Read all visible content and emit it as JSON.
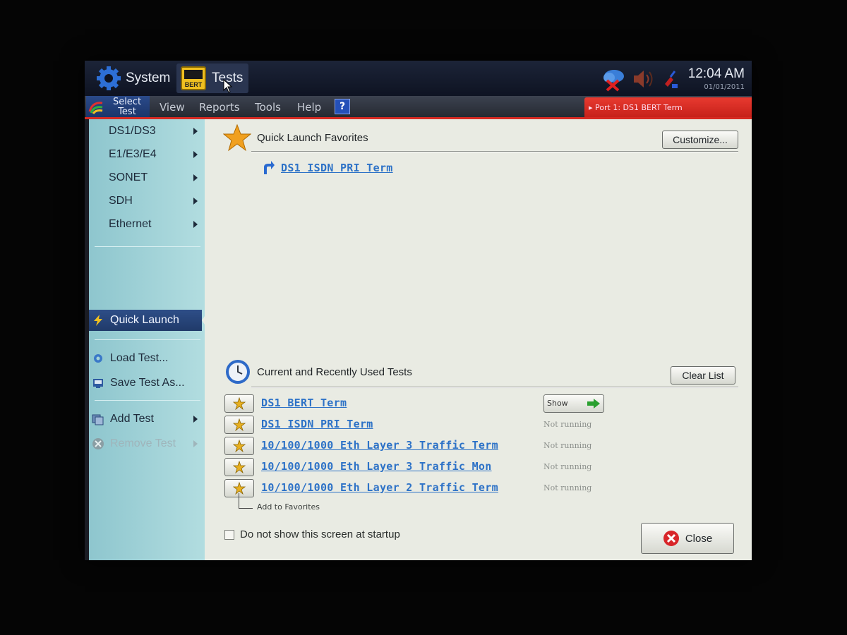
{
  "topbar": {
    "system_label": "System",
    "tests_label": "Tests",
    "bert_icon_text": "BERT",
    "clock_time": "12:04 AM",
    "clock_date": "01/01/2011"
  },
  "menubar": {
    "select_test_line1": "Select",
    "select_test_line2": "Test",
    "items": [
      "View",
      "Reports",
      "Tools",
      "Help"
    ],
    "port_tab": "Port 1: DS1 BERT Term"
  },
  "sidebar": {
    "items": [
      {
        "label": "DS1/DS3"
      },
      {
        "label": "E1/E3/E4"
      },
      {
        "label": "SONET"
      },
      {
        "label": "SDH"
      },
      {
        "label": "Ethernet"
      }
    ],
    "quick_launch": "Quick Launch",
    "load_test": "Load Test...",
    "save_test_as": "Save Test As...",
    "add_test": "Add Test",
    "remove_test": "Remove Test"
  },
  "favorites": {
    "title": "Quick Launch Favorites",
    "customize_label": "Customize...",
    "items": [
      "DS1 ISDN PRI Term"
    ]
  },
  "recent": {
    "title": "Current and Recently Used Tests",
    "clear_label": "Clear List",
    "show_label": "Show",
    "rows": [
      {
        "name": "DS1 BERT Term",
        "status": ""
      },
      {
        "name": "DS1 ISDN PRI Term",
        "status": "Not running"
      },
      {
        "name": "10/100/1000 Eth Layer 3 Traffic Term",
        "status": "Not running"
      },
      {
        "name": "10/100/1000 Eth Layer 3 Traffic Mon",
        "status": "Not running"
      },
      {
        "name": "10/100/1000 Eth Layer 2 Traffic Term",
        "status": "Not running"
      }
    ],
    "add_to_favorites": "Add to Favorites"
  },
  "footer": {
    "startup_checkbox_label": "Do not show this screen at startup",
    "close_label": "Close"
  },
  "colors": {
    "accent_red": "#d62a22",
    "link_blue": "#2d72c7",
    "sidebar_bg": "#a6d4d8",
    "selected_blue": "#2e4e88"
  }
}
